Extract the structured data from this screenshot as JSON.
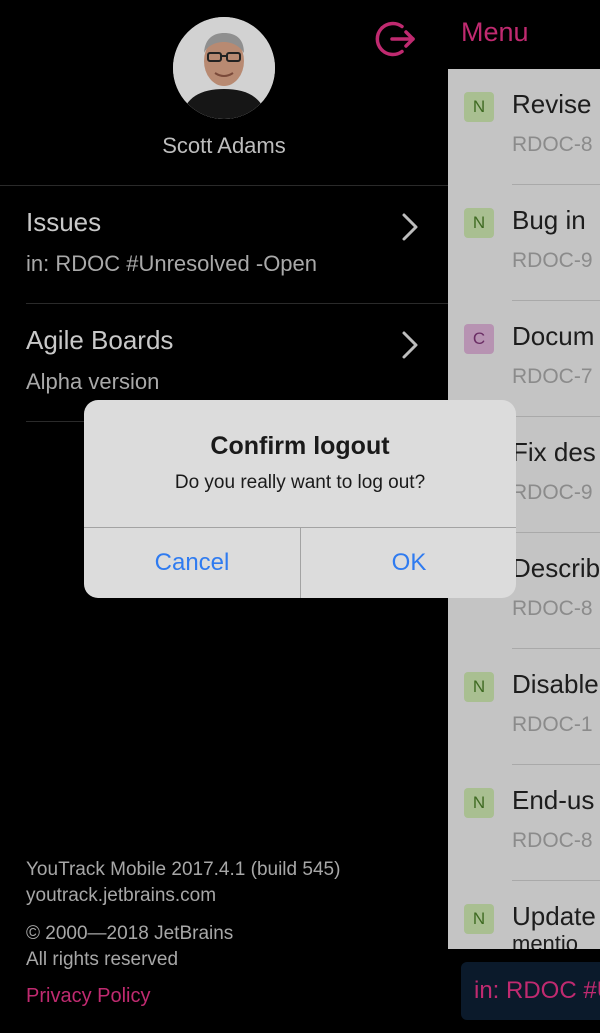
{
  "header": {
    "menu_label": "Menu"
  },
  "profile": {
    "name": "Scott Adams"
  },
  "menu": [
    {
      "title": "Issues",
      "subtitle": "in: RDOC #Unresolved -Open"
    },
    {
      "title": "Agile Boards",
      "subtitle": "Alpha version"
    }
  ],
  "footer": {
    "version": "YouTrack Mobile 2017.4.1 (build 545)",
    "host": "youtrack.jetbrains.com",
    "copyright": "© 2000—2018 JetBrains",
    "rights": "All rights reserved",
    "privacy": "Privacy Policy"
  },
  "issues": [
    {
      "priority": "N",
      "title": "Revise",
      "id": "RDOC-8"
    },
    {
      "priority": "N",
      "title": "Bug in",
      "id": "RDOC-9"
    },
    {
      "priority": "C",
      "title": "Docum",
      "id": "RDOC-7"
    },
    {
      "priority": "",
      "title": "Fix des",
      "id": "RDOC-9"
    },
    {
      "priority": "",
      "title": "Describ",
      "id": "RDOC-8"
    },
    {
      "priority": "N",
      "title": "Disable",
      "id": "RDOC-1"
    },
    {
      "priority": "N",
      "title": "End-us",
      "id": "RDOC-8"
    },
    {
      "priority": "N",
      "title": "Update",
      "id": "mentio"
    }
  ],
  "search_query": "in: RDOC #U",
  "dialog": {
    "title": "Confirm logout",
    "message": "Do you really want to log out?",
    "cancel": "Cancel",
    "ok": "OK"
  },
  "colors": {
    "accent": "#c02a70",
    "dialog_button": "#2f7bf0",
    "background": "#000000"
  },
  "icons": {
    "logout": "logout-icon",
    "chevron": "chevron-right-icon"
  }
}
